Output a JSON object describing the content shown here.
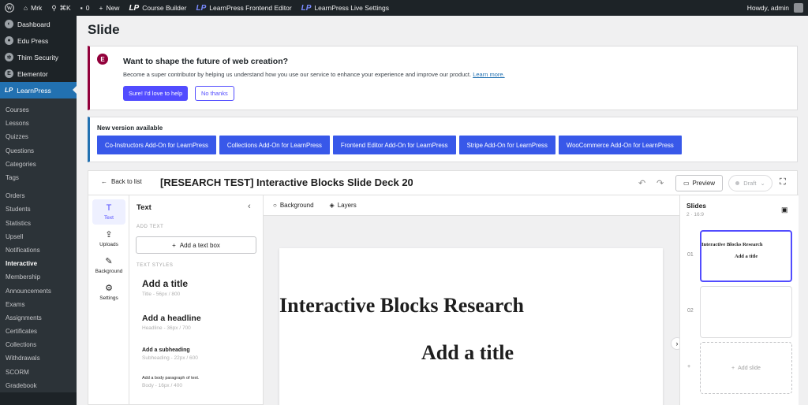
{
  "adminbar": {
    "site": "Mrk",
    "shortcut": "⌘K",
    "comments": "0",
    "new": "New",
    "course_builder": "Course Builder",
    "frontend_editor": "LearnPress Frontend Editor",
    "live_settings": "LearnPress Live Settings",
    "howdy": "Howdy, admin"
  },
  "sidebar": {
    "top_items": [
      {
        "label": "Dashboard"
      },
      {
        "label": "Edu Press"
      },
      {
        "label": "Thim Security"
      },
      {
        "label": "Elementor"
      },
      {
        "label": "LearnPress"
      }
    ],
    "sub_items": [
      "Courses",
      "Lessons",
      "Quizzes",
      "Questions",
      "Categories",
      "Tags"
    ],
    "sub_items2": [
      "Orders",
      "Students",
      "Statistics",
      "Upsell",
      "Notifications",
      "Interactive",
      "Membership",
      "Announcements",
      "Exams",
      "Assignments",
      "Certificates",
      "Collections",
      "Withdrawals",
      "SCORM",
      "Gradebook"
    ],
    "current": "Interactive"
  },
  "page": {
    "title": "Slide"
  },
  "notice_elementor": {
    "badge": "E",
    "title": "Want to shape the future of web creation?",
    "text": "Become a super contributor by helping us understand how you use our service to enhance your experience and improve our product.",
    "link": "Learn more.",
    "primary": "Sure! I'd love to help",
    "secondary": "No thanks"
  },
  "notice_version": {
    "title": "New version available",
    "addons": [
      "Co-Instructors Add-On for LearnPress",
      "Collections Add-On for LearnPress",
      "Frontend Editor Add-On for LearnPress",
      "Stripe Add-On for LearnPress",
      "WooCommerce Add-On for LearnPress"
    ]
  },
  "editor": {
    "back": "Back to list",
    "doc_title": "[RESEARCH TEST] Interactive Blocks Slide Deck 20",
    "preview": "Preview",
    "status": "Draft",
    "tools": [
      "Text",
      "Uploads",
      "Background",
      "Settings"
    ],
    "panel": {
      "title": "Text",
      "add_section": "ADD TEXT",
      "add_box": "Add a text box",
      "styles_section": "TEXT STYLES",
      "styles": [
        {
          "name": "Add a title",
          "meta": "Title - 56px / 800"
        },
        {
          "name": "Add a headline",
          "meta": "Headline - 36px / 700"
        },
        {
          "name": "Add a subheading",
          "meta": "Subheading - 22px / 600"
        },
        {
          "name": "Add a body paragraph of text.",
          "meta": "Body - 16px / 400"
        }
      ]
    },
    "canvas_bar": {
      "background": "Background",
      "layers": "Layers"
    },
    "slide": {
      "line1": "Interactive Blocks Research",
      "line2": "Add a title"
    },
    "slides_panel": {
      "title": "Slides",
      "meta": "2 · 16:9",
      "nums": [
        "01",
        "02",
        "+"
      ],
      "thumb1_line1": "Interactive Blocks Research",
      "thumb1_line2": "Add a title",
      "add_slide": "Add slide"
    }
  }
}
